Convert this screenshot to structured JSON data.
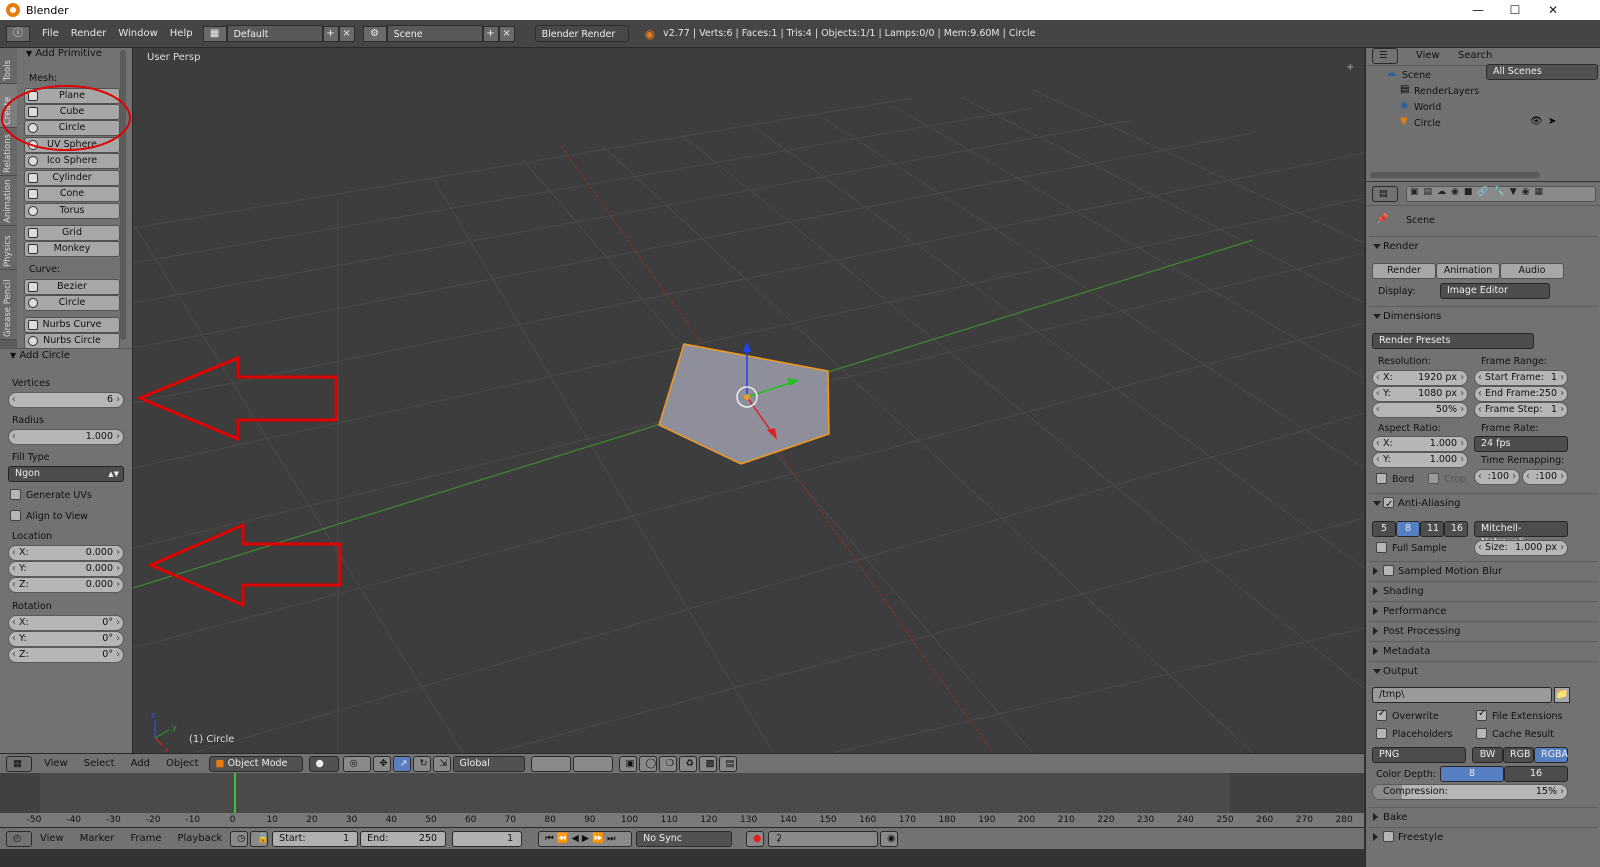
{
  "window": {
    "title": "Blender"
  },
  "infobar": {
    "menus": [
      "File",
      "Render",
      "Window",
      "Help"
    ],
    "screen_layout": "Default",
    "scene": "Scene",
    "engine": "Blender Render",
    "stats": "v2.77 | Verts:6 | Faces:1 | Tris:4 | Objects:1/1 | Lamps:0/0 | Mem:9.60M | Circle"
  },
  "toolshelf": {
    "tabs": [
      "Tools",
      "Create",
      "Relations",
      "Animation",
      "Physics",
      "Grease Pencil"
    ],
    "add_primitive": {
      "title": "Add Primitive",
      "mesh_label": "Mesh:",
      "mesh": [
        "Plane",
        "Cube",
        "Circle",
        "UV Sphere",
        "Ico Sphere",
        "Cylinder",
        "Cone",
        "Torus",
        "Grid",
        "Monkey"
      ],
      "curve_label": "Curve:",
      "curve": [
        "Bezier",
        "Circle",
        "Nurbs Curve",
        "Nurbs Circle"
      ]
    },
    "operator": {
      "title": "Add Circle",
      "vertices_label": "Vertices",
      "vertices": "6",
      "radius_label": "Radius",
      "radius": "1.000",
      "fill_type_label": "Fill Type",
      "fill_type": "Ngon",
      "generate_uvs": "Generate UVs",
      "align_to_view": "Align to View",
      "location_label": "Location",
      "location": [
        {
          "axis": "X:",
          "value": "0.000"
        },
        {
          "axis": "Y:",
          "value": "0.000"
        },
        {
          "axis": "Z:",
          "value": "0.000"
        }
      ],
      "rotation_label": "Rotation",
      "rotation": [
        {
          "axis": "X:",
          "value": "0°"
        },
        {
          "axis": "Y:",
          "value": "0°"
        },
        {
          "axis": "Z:",
          "value": "0°"
        }
      ]
    }
  },
  "viewport": {
    "view_name": "User Persp",
    "active_object": "(1) Circle"
  },
  "outliner": {
    "menus": [
      "View",
      "Search"
    ],
    "filter": "All Scenes",
    "tree": [
      {
        "name": "Scene",
        "depth": 0
      },
      {
        "name": "RenderLayers",
        "depth": 1
      },
      {
        "name": "World",
        "depth": 1
      },
      {
        "name": "Circle",
        "depth": 1
      }
    ]
  },
  "properties": {
    "context": "Scene",
    "render": {
      "title": "Render",
      "buttons": [
        "Render",
        "Animation",
        "Audio"
      ],
      "display_label": "Display:",
      "display": "Image Editor"
    },
    "dimensions": {
      "title": "Dimensions",
      "presets": "Render Presets",
      "resolution_label": "Resolution:",
      "res_x": "X:",
      "res_x_val": "1920 px",
      "res_y": "Y:",
      "res_y_val": "1080 px",
      "res_pct": "50%",
      "frame_range_label": "Frame Range:",
      "start_frame": "Start Frame:",
      "start_frame_val": "1",
      "end_frame": "End Frame:",
      "end_frame_val": "250",
      "frame_step": "Frame Step:",
      "frame_step_val": "1",
      "aspect_label": "Aspect Ratio:",
      "asp_x": "X:",
      "asp_x_val": "1.000",
      "asp_y": "Y:",
      "asp_y_val": "1.000",
      "frame_rate_label": "Frame Rate:",
      "frame_rate": "24 fps",
      "time_remap_label": "Time Remapping:",
      "remap_old": ":100",
      "remap_new": ":100",
      "border": "Bord",
      "crop": "Crop"
    },
    "anti_aliasing": {
      "title": "Anti-Aliasing",
      "samples": [
        "5",
        "8",
        "11",
        "16"
      ],
      "filter": "Mitchell-Netravali",
      "full_sample": "Full Sample",
      "size_label": "Size:",
      "size": "1.000 px"
    },
    "closed_panels": [
      "Sampled Motion Blur",
      "Shading",
      "Performance",
      "Post Processing",
      "Metadata"
    ],
    "output": {
      "title": "Output",
      "path": "/tmp\\",
      "overwrite": "Overwrite",
      "file_extensions": "File Extensions",
      "placeholders": "Placeholders",
      "cache_result": "Cache Result",
      "format": "PNG",
      "color_modes": [
        "BW",
        "RGB",
        "RGBA"
      ],
      "color_depth_label": "Color Depth:",
      "depths": [
        "8",
        "16"
      ],
      "compression_label": "Compression:",
      "compression": "15%",
      "compression_value": 0.15
    },
    "bottom_panels": [
      "Bake",
      "Freestyle"
    ]
  },
  "view3d_header": {
    "menus": [
      "View",
      "Select",
      "Add",
      "Object"
    ],
    "mode": "Object Mode",
    "orientation": "Global"
  },
  "timeline": {
    "ticks": [
      "-50",
      "-40",
      "-30",
      "-20",
      "-10",
      "0",
      "10",
      "20",
      "30",
      "40",
      "50",
      "60",
      "70",
      "80",
      "90",
      "100",
      "110",
      "120",
      "130",
      "140",
      "150",
      "160",
      "170",
      "180",
      "190",
      "200",
      "210",
      "220",
      "230",
      "240",
      "250",
      "260",
      "270",
      "280"
    ],
    "menus": [
      "View",
      "Marker",
      "Frame",
      "Playback"
    ],
    "start_label": "Start:",
    "start": "1",
    "end_label": "End:",
    "end": "250",
    "current": "1",
    "sync": "No Sync"
  }
}
